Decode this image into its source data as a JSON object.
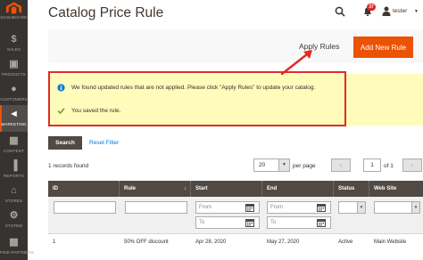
{
  "sidebar": {
    "items": [
      {
        "label": "DASHBOARD",
        "icon": "dashboard-icon"
      },
      {
        "label": "SALES",
        "icon": "dollar-icon"
      },
      {
        "label": "PRODUCTS",
        "icon": "cube-icon"
      },
      {
        "label": "CUSTOMERS",
        "icon": "person-icon"
      },
      {
        "label": "MARKETING",
        "icon": "megaphone-icon"
      },
      {
        "label": "CONTENT",
        "icon": "layout-icon"
      },
      {
        "label": "REPORTS",
        "icon": "bar-chart-icon"
      },
      {
        "label": "STORES",
        "icon": "store-icon"
      },
      {
        "label": "SYSTEM",
        "icon": "gear-icon"
      },
      {
        "label": "FIND PARTNERS",
        "icon": "puzzle-icon"
      }
    ],
    "active": "MARKETING"
  },
  "header": {
    "title": "Catalog Price Rule",
    "notifications_count": "37",
    "user_name": "tester"
  },
  "actions": {
    "apply_rules": "Apply Rules",
    "add_new_rule": "Add New Rule"
  },
  "messages": {
    "info": "We found updated rules that are not applied. Please click \"Apply Rules\" to update your catalog.",
    "success": "You saved the rule."
  },
  "toolbar": {
    "search": "Search",
    "reset_filter": "Reset Filter",
    "records_found": "1 records found",
    "per_page_value": "20",
    "per_page_label": "per page",
    "current_page": "1",
    "of_pages": "of 1"
  },
  "grid": {
    "columns": [
      "ID",
      "Rule",
      "Start",
      "End",
      "Status",
      "Web Site"
    ],
    "filter_placeholders": {
      "from": "From",
      "to": "To"
    },
    "rows": [
      {
        "id": "1",
        "rule": "50% OFF discount",
        "start": "Apr 28, 2020",
        "end": "May 27, 2020",
        "status": "Active",
        "website": "Main Website"
      }
    ]
  },
  "colors": {
    "sidebar_bg": "#373330",
    "accent": "#eb5202",
    "message_bg": "#fffbbb",
    "highlight": "#e02b27",
    "grid_header": "#514943",
    "link": "#007bdb"
  }
}
